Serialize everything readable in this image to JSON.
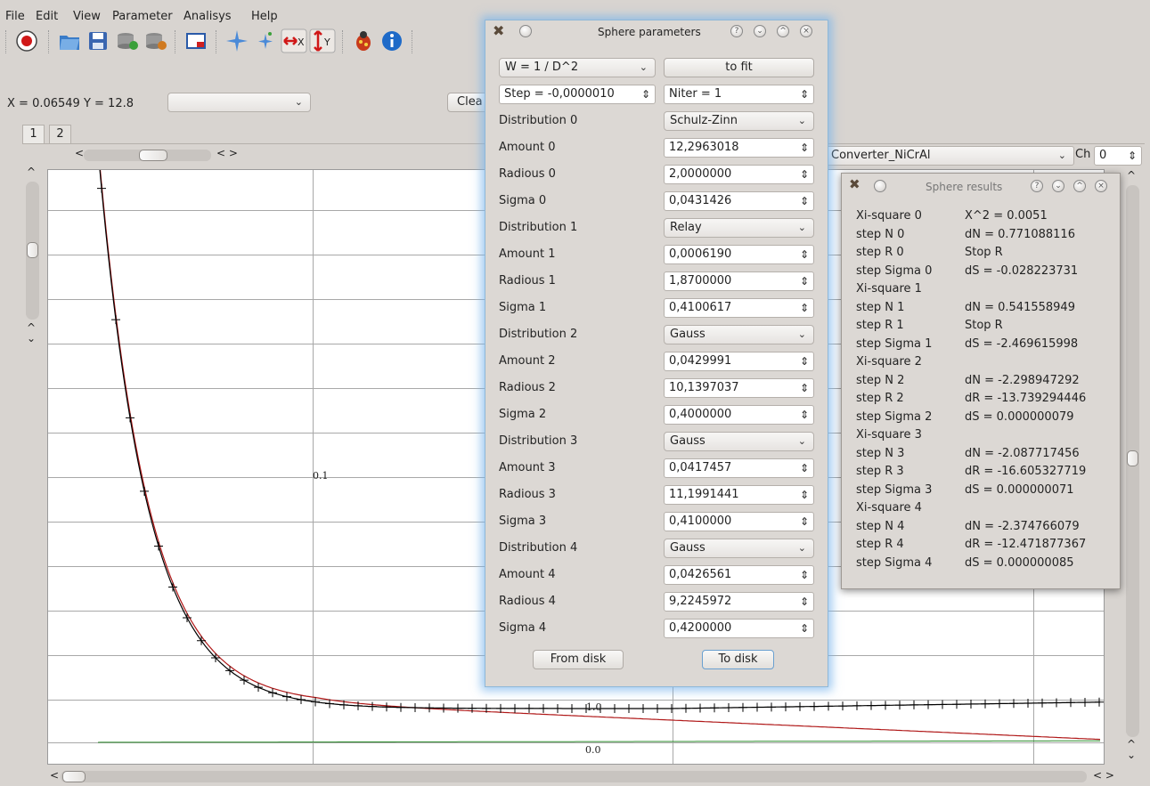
{
  "menu": [
    "File",
    "Edit",
    "View",
    "Parameter",
    "Analisys",
    "Help"
  ],
  "coords": {
    "text": "X  = 0.06549 Y  = 12.8",
    "combo_value": "",
    "clear_label": "Clea"
  },
  "tabs": [
    "1",
    "2"
  ],
  "converter": {
    "value": "Converter_NiCrAl",
    "ch_label": "Ch",
    "ch_value": "0"
  },
  "plot": {
    "label_center": "0.1",
    "label_bottom_mid": "1.0",
    "label_axis": "0.0"
  },
  "params_dialog": {
    "title": "Sphere parameters",
    "weight": "W = 1 / D^2",
    "to_fit": "to fit",
    "step": "Step = -0,0000010",
    "niter": "Niter = 1",
    "rows": [
      {
        "label": "Distribution 0",
        "value": "Schulz-Zinn",
        "kind": "combo"
      },
      {
        "label": "Amount 0",
        "value": "12,2963018",
        "kind": "spin"
      },
      {
        "label": "Radious 0",
        "value": "2,0000000",
        "kind": "spin"
      },
      {
        "label": "Sigma 0",
        "value": "0,0431426",
        "kind": "spin"
      },
      {
        "label": "Distribution 1",
        "value": "Relay",
        "kind": "combo"
      },
      {
        "label": "Amount 1",
        "value": "0,0006190",
        "kind": "spin"
      },
      {
        "label": "Radious 1",
        "value": "1,8700000",
        "kind": "spin"
      },
      {
        "label": "Sigma 1",
        "value": "0,4100617",
        "kind": "spin"
      },
      {
        "label": "Distribution 2",
        "value": "Gauss",
        "kind": "combo"
      },
      {
        "label": "Amount 2",
        "value": "0,0429991",
        "kind": "spin"
      },
      {
        "label": "Radious 2",
        "value": "10,1397037",
        "kind": "spin"
      },
      {
        "label": "Sigma 2",
        "value": "0,4000000",
        "kind": "spin"
      },
      {
        "label": "Distribution 3",
        "value": "Gauss",
        "kind": "combo"
      },
      {
        "label": "Amount 3",
        "value": "0,0417457",
        "kind": "spin"
      },
      {
        "label": "Radious 3",
        "value": "11,1991441",
        "kind": "spin"
      },
      {
        "label": "Sigma 3",
        "value": "0,4100000",
        "kind": "spin"
      },
      {
        "label": "Distribution 4",
        "value": "Gauss",
        "kind": "combo"
      },
      {
        "label": "Amount 4",
        "value": "0,0426561",
        "kind": "spin"
      },
      {
        "label": "Radious 4",
        "value": "9,2245972",
        "kind": "spin"
      },
      {
        "label": "Sigma 4",
        "value": "0,4200000",
        "kind": "spin"
      }
    ],
    "from_disk": "From disk",
    "to_disk": "To disk"
  },
  "results_dialog": {
    "title": "Sphere results",
    "rows": [
      [
        "Xi-square 0",
        "X^2 = 0.0051"
      ],
      [
        "step N 0",
        "dN = 0.771088116"
      ],
      [
        "step R 0",
        "Stop R"
      ],
      [
        "step Sigma 0",
        "dS = -0.028223731"
      ],
      [
        "Xi-square 1",
        ""
      ],
      [
        "step N 1",
        "dN = 0.541558949"
      ],
      [
        "step R 1",
        "Stop R"
      ],
      [
        "step Sigma 1",
        "dS = -2.469615998"
      ],
      [
        "Xi-square 2",
        ""
      ],
      [
        "step N 2",
        "dN = -2.298947292"
      ],
      [
        "step R 2",
        "dR = -13.739294446"
      ],
      [
        "step Sigma 2",
        "dS = 0.000000079"
      ],
      [
        "Xi-square 3",
        ""
      ],
      [
        "step N 3",
        "dN = -2.087717456"
      ],
      [
        "step R 3",
        "dR = -16.605327719"
      ],
      [
        "step Sigma 3",
        "dS = 0.000000071"
      ],
      [
        "Xi-square 4",
        ""
      ],
      [
        "step N 4",
        "dN = -2.374766079"
      ],
      [
        "step R 4",
        "dR = -12.471877367"
      ],
      [
        "step Sigma 4",
        "dS = 0.000000085"
      ]
    ]
  },
  "colors": {
    "fit_line": "#b01818",
    "data_line": "#000000",
    "baseline": "#2a8a2a",
    "dialog_glow": "#78b4eb"
  }
}
